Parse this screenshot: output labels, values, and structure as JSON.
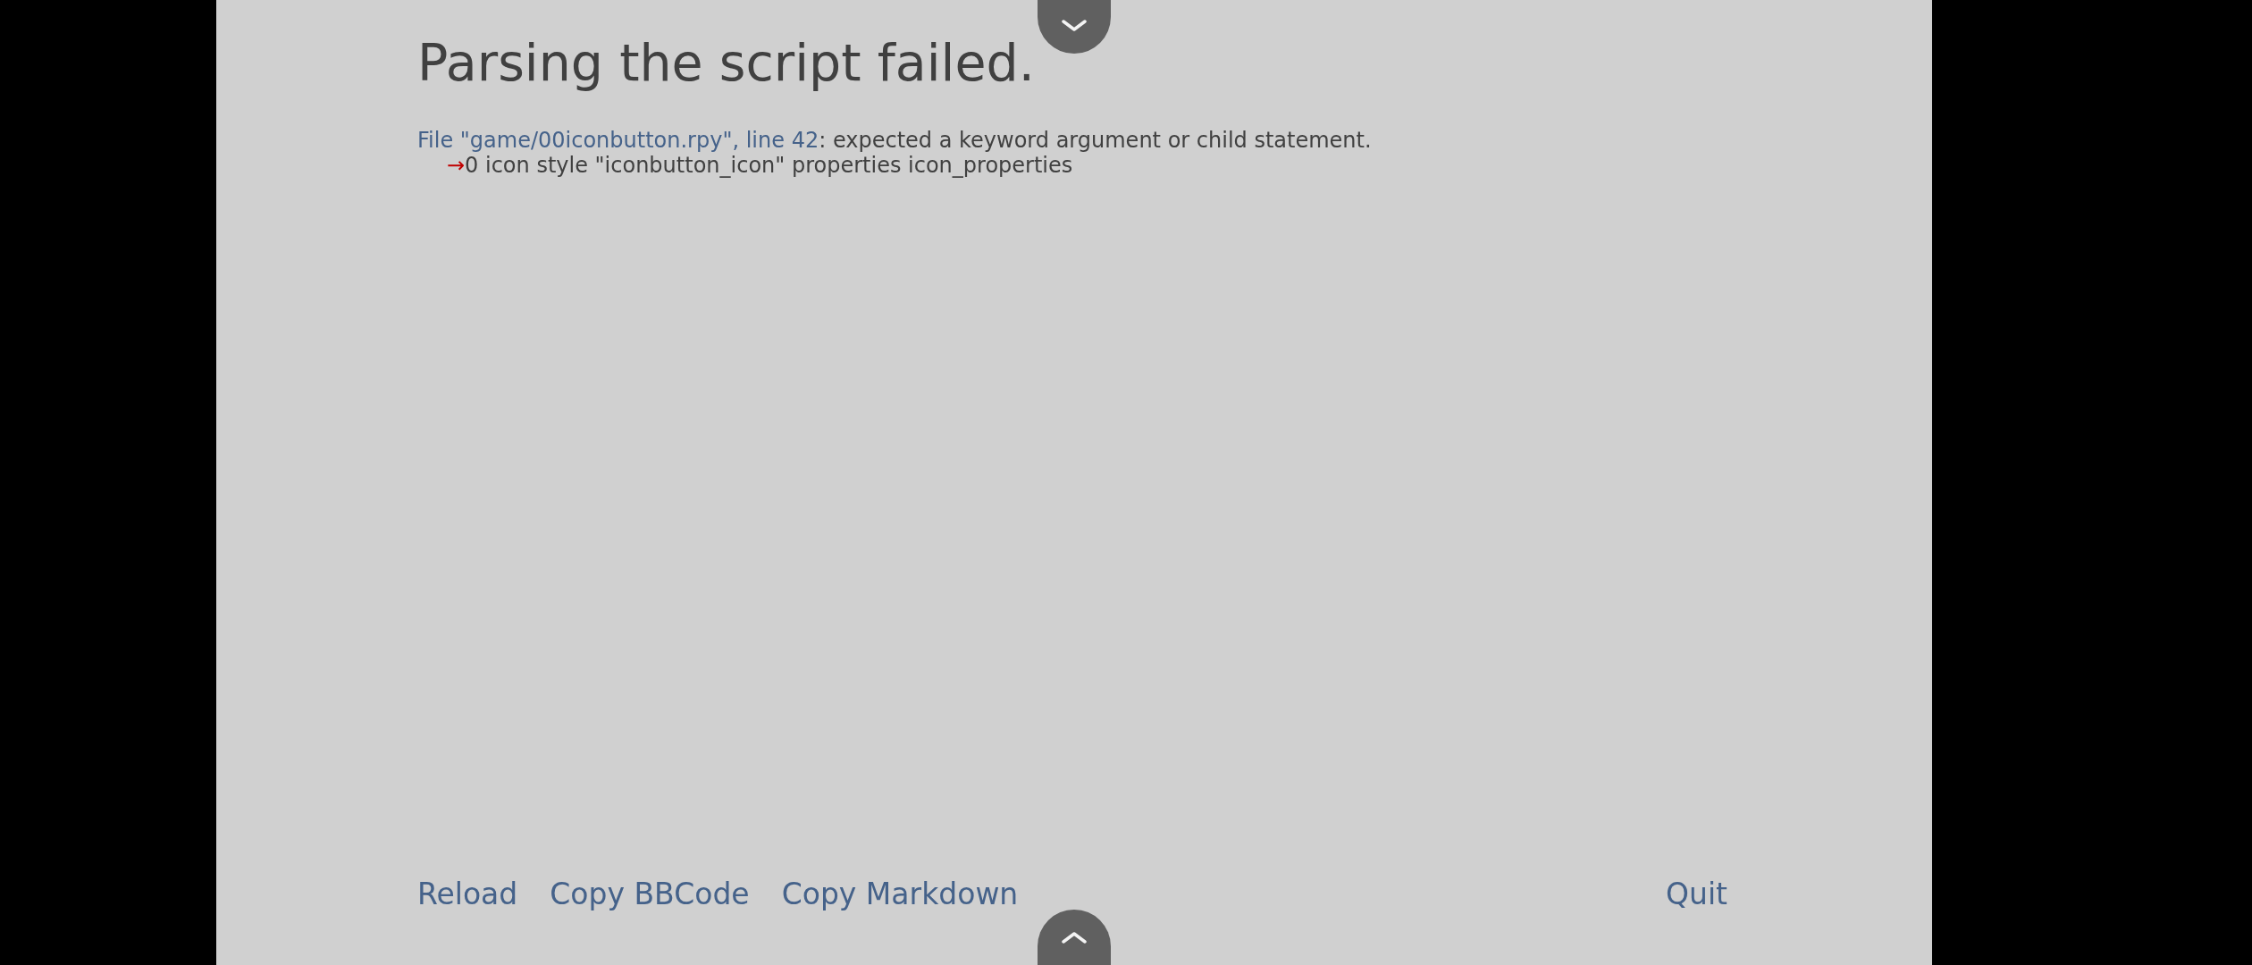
{
  "title": "Parsing the script failed.",
  "error": {
    "location": "File \"game/00iconbutton.rpy\", line 42",
    "message": ": expected a keyword argument or child statement.",
    "arrow": "→",
    "code": "0 icon style \"iconbutton_icon\" properties icon_properties"
  },
  "actions": [
    {
      "label": "Reload"
    },
    {
      "label": "Copy BBCode"
    },
    {
      "label": "Copy Markdown"
    }
  ],
  "quit": {
    "label": "Quit"
  }
}
